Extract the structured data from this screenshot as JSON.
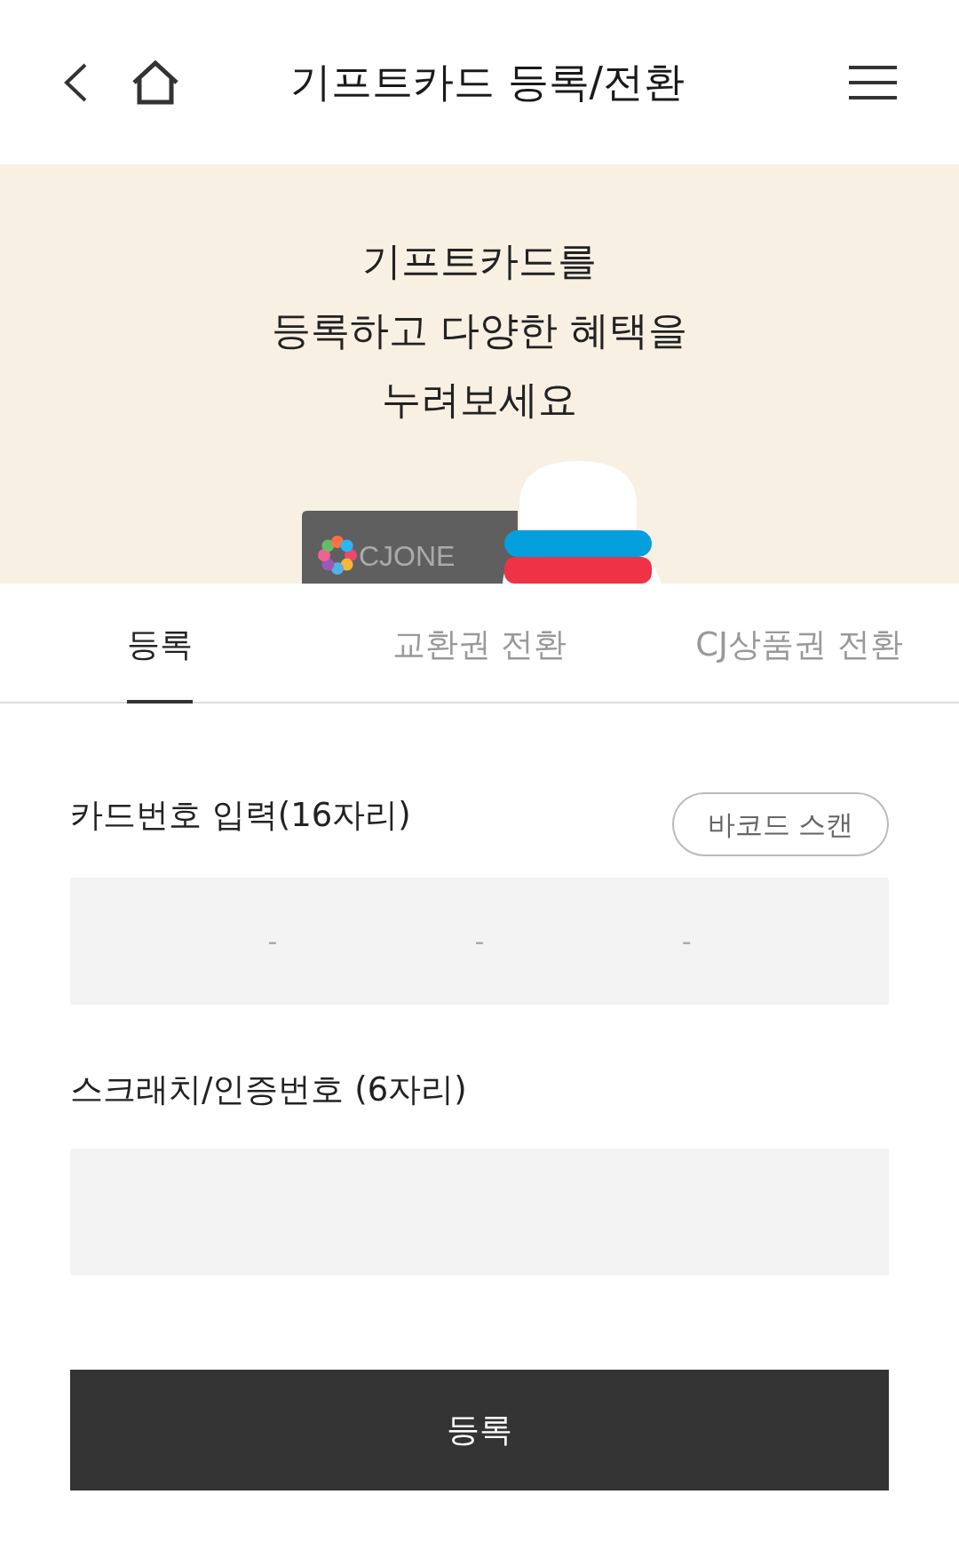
{
  "header": {
    "title": "기프트카드 등록/전환"
  },
  "banner": {
    "lines": [
      "기프트카드를",
      "등록하고 다양한 혜택을",
      "누려보세요"
    ],
    "card_logo": "CJONE"
  },
  "tabs": [
    {
      "label": "등록",
      "selected": true
    },
    {
      "label": "교환권 전환",
      "selected": false
    },
    {
      "label": "CJ상품권 전환",
      "selected": false
    }
  ],
  "card_number": {
    "label": "카드번호 입력(16자리)",
    "scan_button": "바코드 스캔",
    "separators": [
      "-",
      "-",
      "-"
    ]
  },
  "scratch_code": {
    "label": "스크래치/인증번호 (6자리)"
  },
  "submit_button": "등록"
}
